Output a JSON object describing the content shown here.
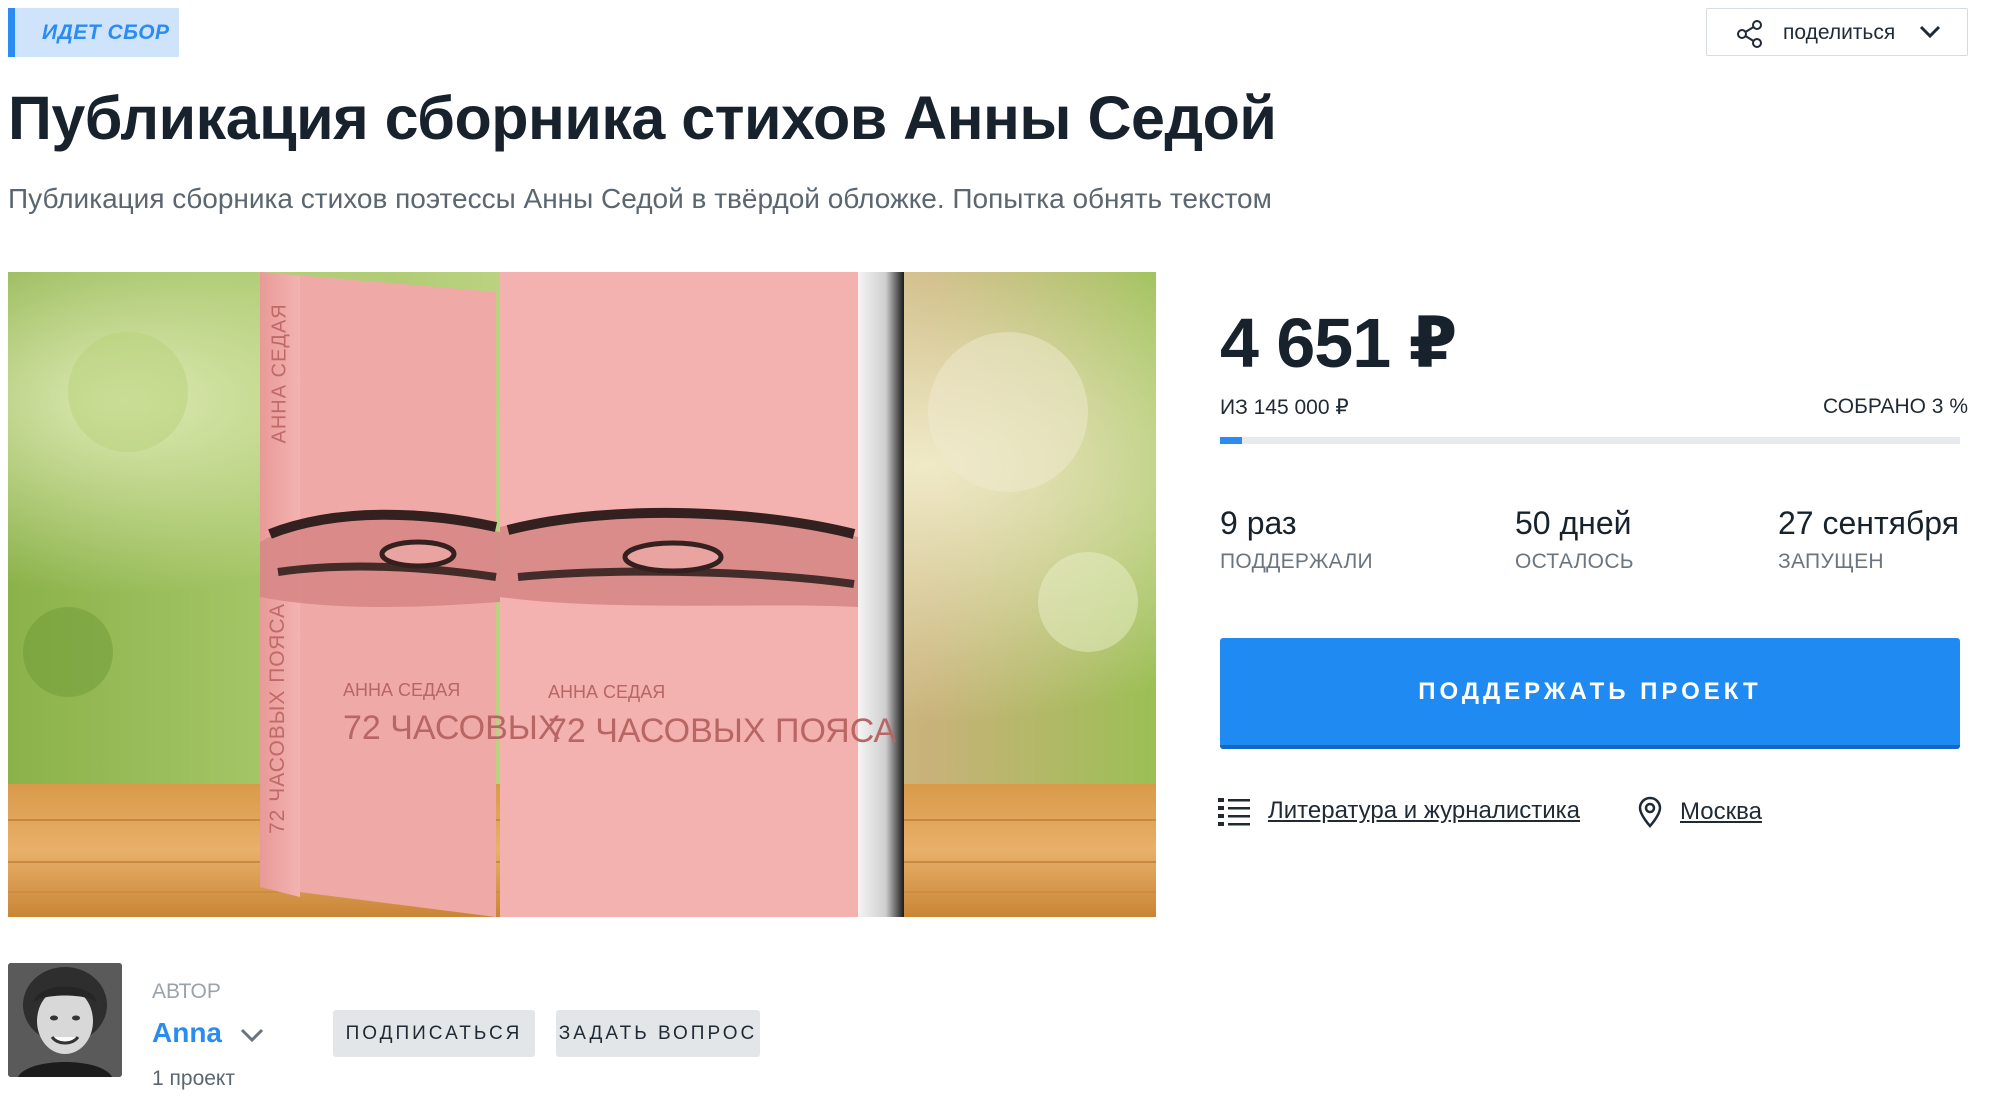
{
  "status": {
    "label": "ИДЕТ СБОР"
  },
  "share": {
    "label": "поделиться",
    "icon": "share-icon"
  },
  "project": {
    "title": "Публикация сборника стихов Анны Седой",
    "subtitle": "Публикация сборника стихов поэтессы Анны Седой в твёрдой обложке. Попытка обнять текстом",
    "cover": {
      "spine_author": "АННА СЕДАЯ",
      "spine_title": "72 ЧАСОВЫХ ПОЯСА",
      "front_author": "АННА СЕДАЯ",
      "front_title": "72 ЧАСОВЫХ ПОЯСА",
      "back_author": "АННА СЕДАЯ",
      "back_title": "72 ЧАСОВЫХ"
    }
  },
  "funding": {
    "amount": "4 651 ₽",
    "goal": "ИЗ 145 000 ₽",
    "collected": "СОБРАНО 3 %",
    "progress_fraction": 0.03
  },
  "stats": [
    {
      "value": "9 раз",
      "label": "ПОДДЕРЖАЛИ"
    },
    {
      "value": "50 дней",
      "label": "ОСТАЛОСЬ"
    },
    {
      "value": "27 сентября",
      "label": "ЗАПУЩЕН"
    }
  ],
  "actions": {
    "support": "ПОДДЕРЖАТЬ ПРОЕКТ"
  },
  "meta": {
    "category": "Литература и журналистика",
    "category_icon": "list-icon",
    "city": "Москва",
    "city_icon": "location-pin-icon"
  },
  "author": {
    "label": "АВТОР",
    "name": "Anna",
    "projects": "1 проект",
    "subscribe": "ПОДПИСАТЬСЯ",
    "ask": "ЗАДАТЬ ВОПРОС"
  },
  "colors": {
    "accent": "#2a8cf2",
    "badge_bg": "#cfe4fb",
    "title": "#17222d",
    "book_pink": "#f2b0ae"
  }
}
